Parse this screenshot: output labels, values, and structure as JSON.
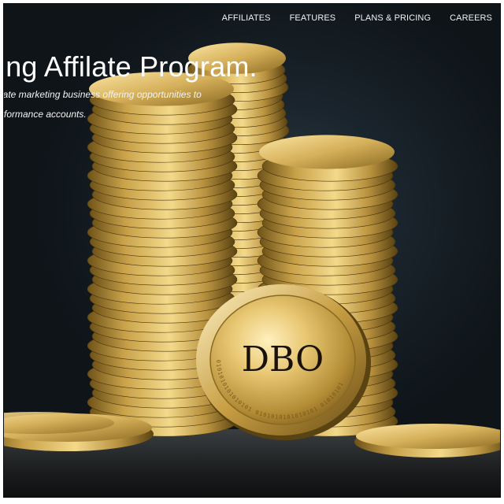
{
  "nav": {
    "items": [
      {
        "label": "AFFILIATES"
      },
      {
        "label": "FEATURES"
      },
      {
        "label": "PLANS & PRICING"
      },
      {
        "label": "CAREERS"
      }
    ]
  },
  "hero": {
    "title": "ing Affilate Program.",
    "subtitle_line1": "iate marketing business offering opportunities to",
    "subtitle_line2": "rformance accounts."
  },
  "coin": {
    "label": "DBO",
    "edge_text": "0101010101010101 0101010101010101 01010101"
  },
  "colors": {
    "background": "#1a242c",
    "gold": "#c9a24a",
    "gold_light": "#f3d98a",
    "gold_dark": "#6e5218",
    "nav_text": "#f2f2f2"
  }
}
